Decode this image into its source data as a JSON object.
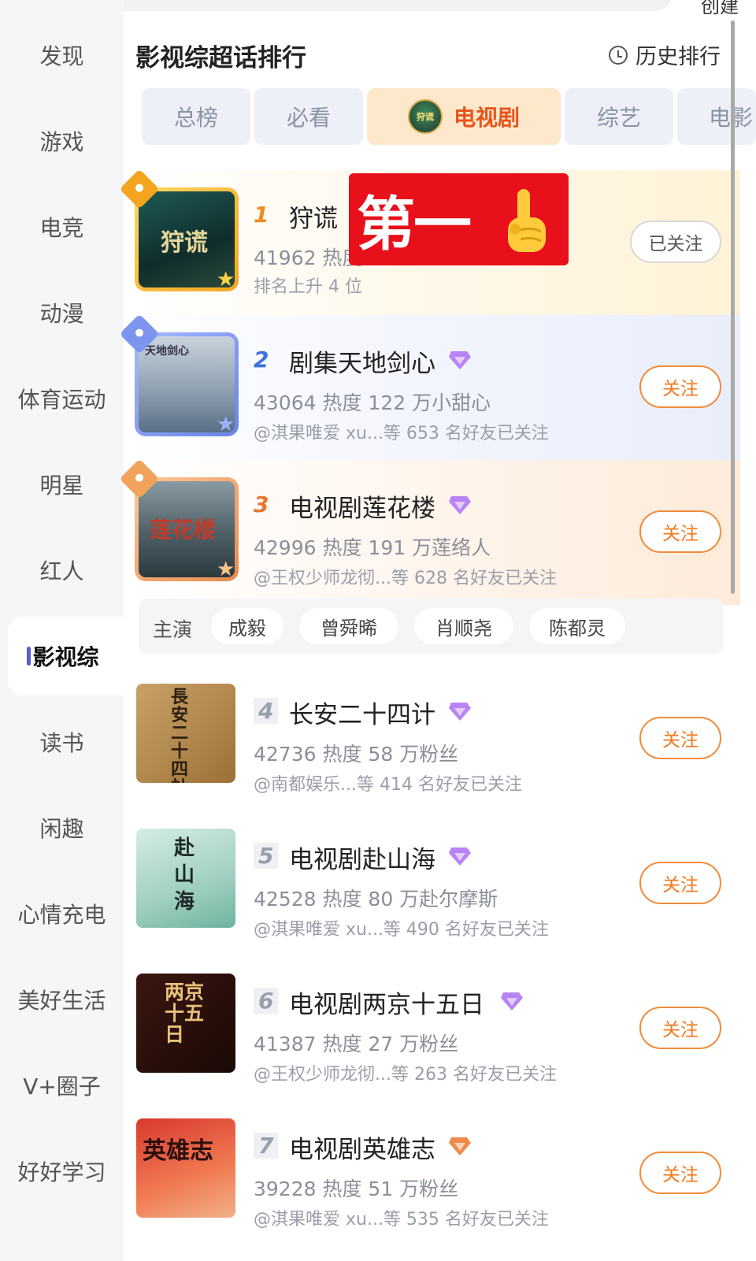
{
  "top_partial": {
    "right_text": "创建"
  },
  "sidebar": {
    "items": [
      {
        "label": "发现"
      },
      {
        "label": "游戏"
      },
      {
        "label": "电竞"
      },
      {
        "label": "动漫"
      },
      {
        "label": "体育运动"
      },
      {
        "label": "明星"
      },
      {
        "label": "红人"
      },
      {
        "label": "影视综",
        "active": true
      },
      {
        "label": "读书"
      },
      {
        "label": "闲趣"
      },
      {
        "label": "心情充电"
      },
      {
        "label": "美好生活"
      },
      {
        "label": "V+圈子"
      },
      {
        "label": "好好学习"
      }
    ]
  },
  "header": {
    "title": "影视综超话排行",
    "history_label": "历史排行",
    "history_icon": "clock-icon"
  },
  "tabs": [
    {
      "label": "总榜"
    },
    {
      "label": "必看"
    },
    {
      "label": "电视剧",
      "active": true,
      "logo_text": "狩谎"
    },
    {
      "label": "综艺"
    },
    {
      "label": "电影"
    }
  ],
  "overlay": {
    "text": "第一",
    "icon": "pointing-up-finger-icon",
    "color": "#e8101a"
  },
  "rankings": [
    {
      "rank": "1",
      "name": "狩谎",
      "stats": "41962 热度",
      "sub": "排名上升 4 位",
      "button": "已关注",
      "poster_text": "狩谎"
    },
    {
      "rank": "2",
      "name": "剧集天地剑心",
      "stats": "43064 热度  122 万小甜心",
      "sub": "@淇果唯爱 xu...等 653 名好友已关注",
      "button": "关注",
      "poster_text": "天地剑心"
    },
    {
      "rank": "3",
      "name": "电视剧莲花楼",
      "stats": "42996 热度  191 万莲络人",
      "sub": "@王权少师龙彻...等 628 名好友已关注",
      "button": "关注",
      "poster_text": "莲花楼"
    },
    {
      "rank": "4",
      "name": "长安二十四计",
      "stats": "42736 热度  58 万粉丝",
      "sub": "@南都娱乐...等 414 名好友已关注",
      "button": "关注",
      "poster_text": "長安二十四計"
    },
    {
      "rank": "5",
      "name": "电视剧赴山海",
      "stats": "42528 热度  80 万赴尔摩斯",
      "sub": "@淇果唯爱 xu...等 490 名好友已关注",
      "button": "关注",
      "poster_text": "赴山海"
    },
    {
      "rank": "6",
      "name": "电视剧两京十五日",
      "stats": "41387 热度  27 万粉丝",
      "sub": "@王权少师龙彻...等 263 名好友已关注",
      "button": "关注",
      "poster_text": "两京十五日"
    },
    {
      "rank": "7",
      "name": "电视剧英雄志",
      "stats": "39228 热度  51 万粉丝",
      "sub": "@淇果唯爱 xu...等 535 名好友已关注",
      "button": "关注",
      "poster_text": "英雄志"
    }
  ],
  "cast": {
    "label": "主演",
    "names": [
      "成毅",
      "曾舜晞",
      "肖顺尧",
      "陈都灵"
    ]
  },
  "colors": {
    "accent": "#f07a20",
    "active_tab_bg": "#fde8cc",
    "sidebar_bg": "#f5f6f8",
    "active_marker": "#5b5bd6"
  }
}
